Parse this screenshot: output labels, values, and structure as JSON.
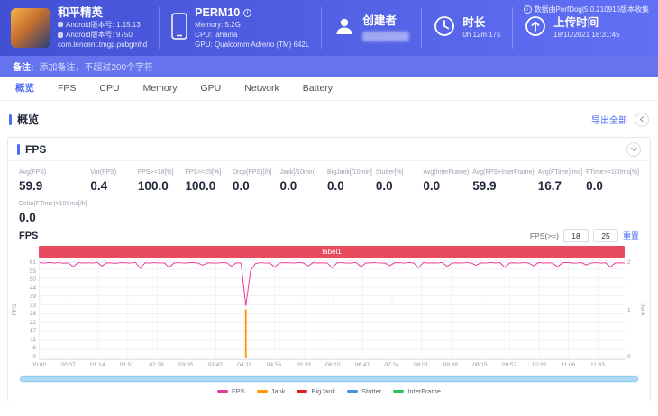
{
  "header": {
    "game": {
      "title": "和平精英",
      "line1": "Android版本号: 1.15.13",
      "line2": "Android版本号: 9750",
      "package": "com.tencent.tmgp.pubgmhd"
    },
    "device": {
      "name": "PERM10",
      "memory": "Memory: 5.2G",
      "cpu": "CPU: lahaina",
      "gpu": "GPU: Qualcomm Adreno (TM) 642L"
    },
    "creator": {
      "label": "创建者"
    },
    "duration": {
      "label": "时长",
      "value": "0h 12m 17s"
    },
    "upload": {
      "label": "上传时间",
      "value": "18/10/2021 18:31:45"
    },
    "collector": "数据由PerfDog|5.0.210910版本收集"
  },
  "note": {
    "label": "备注:",
    "text": "添加备注，不超过200个字符"
  },
  "tabs": [
    {
      "label": "概览"
    },
    {
      "label": "FPS"
    },
    {
      "label": "CPU"
    },
    {
      "label": "Memory"
    },
    {
      "label": "GPU"
    },
    {
      "label": "Network"
    },
    {
      "label": "Battery"
    }
  ],
  "overview": {
    "title": "概览",
    "export_all": "导出全部"
  },
  "fps_panel": {
    "title": "FPS",
    "chart_label": "FPS",
    "metrics": [
      {
        "label": "Avg(FPS)",
        "value": "59.9"
      },
      {
        "label": "Var(FPS)",
        "value": "0.4"
      },
      {
        "label": "FPS>=18[%]",
        "value": "100.0"
      },
      {
        "label": "FPS>=25[%]",
        "value": "100.0"
      },
      {
        "label": "Drop(FPS)[/h]",
        "value": "0.0"
      },
      {
        "label": "Jank[/10min]",
        "value": "0.0"
      },
      {
        "label": "BigJank[/10min]",
        "value": "0.0"
      },
      {
        "label": "Stutter[%]",
        "value": "0.0"
      },
      {
        "label": "Avg(InterFrame)",
        "value": "0.0"
      },
      {
        "label": "Avg(FPS+InterFrame)",
        "value": "59.9"
      },
      {
        "label": "Avg(FTime)[ms]",
        "value": "16.7"
      },
      {
        "label": "FTime>=100ms[%]",
        "value": "0.0"
      },
      {
        "label": "Delta(FTime)>100ms[/h]",
        "value": "0.0"
      }
    ],
    "controls": {
      "threshold_label": "FPS(>=)",
      "input1": "18",
      "input2": "25",
      "reset": "重置"
    }
  },
  "chart_data": {
    "type": "line",
    "title": "FPS over time",
    "duration_seconds": 737,
    "tick_interval_seconds": 37,
    "x_tick_labels": [
      "00:00",
      "00:37",
      "01:14",
      "01:51",
      "02:28",
      "03:05",
      "03:42",
      "04:19",
      "04:56",
      "05:33",
      "06:10",
      "06:47",
      "07:24",
      "08:01",
      "08:38",
      "09:15",
      "09:52",
      "10:29",
      "11:06",
      "11:43"
    ],
    "y_left": {
      "label": "FPS",
      "ticks": [
        61,
        55,
        50,
        44,
        39,
        33,
        28,
        22,
        17,
        11,
        6,
        0
      ],
      "max": 61
    },
    "y_right": {
      "label": "Jank",
      "ticks": [
        2,
        1,
        0
      ],
      "max": 2
    },
    "band_label": "label1",
    "band_color": "#e84a5f",
    "grid": true,
    "legend_position": "bottom",
    "series": [
      {
        "name": "FPS",
        "color": "#e6399b",
        "values": [
          60,
          59.8,
          60.2,
          59.9,
          60.1,
          59.7,
          60,
          57.5,
          60.1,
          59.9,
          60,
          59.8,
          60.2,
          58,
          60,
          59.9,
          59.7,
          60.1,
          60,
          59.8,
          60.2,
          56.5,
          60,
          59.9,
          60.1,
          59.8,
          60,
          57,
          59.9,
          60.1,
          59.8,
          60,
          60.2,
          59.9,
          58.5,
          60,
          59.9,
          59.8,
          60.1,
          60,
          57.8,
          60,
          59.9,
          33,
          55,
          59.5,
          60.1,
          59.8,
          60,
          57.2,
          59.9,
          60.1,
          60,
          59.8,
          60.2,
          59.9,
          58,
          60.1,
          59.9,
          60,
          59.8,
          56.8,
          60,
          60.1,
          59.9,
          59.8,
          60.2,
          57.5,
          59.9,
          60,
          60.1,
          59.8,
          59.9,
          58.2,
          60,
          60.1,
          59.8,
          60.2,
          59.9,
          56.9,
          60.1,
          59.9,
          60,
          59.8,
          60.2,
          57.6,
          59.9,
          60,
          59.8,
          60.1,
          59.9,
          58.4,
          60,
          59.8,
          60.2,
          59.9,
          60.1,
          57.1,
          59.9,
          60,
          59.8,
          60.1,
          59.9,
          58,
          60.1,
          59.9,
          60,
          59.8,
          57.4,
          60,
          60.2,
          59.9,
          59.8,
          60.1,
          58.6,
          59.9,
          60.1,
          59.8,
          60,
          57.3,
          59.9,
          60,
          59.8
        ]
      },
      {
        "name": "Jank",
        "color": "#ff9800",
        "spike_indices": [
          43
        ],
        "spike_values": [
          1
        ]
      }
    ],
    "legend": [
      {
        "name": "FPS",
        "color": "#e6399b"
      },
      {
        "name": "Jank",
        "color": "#ff9800"
      },
      {
        "name": "BigJank",
        "color": "#e02020"
      },
      {
        "name": "Stutter",
        "color": "#4a90e2"
      },
      {
        "name": "InterFrame",
        "color": "#2fc25b"
      }
    ]
  }
}
